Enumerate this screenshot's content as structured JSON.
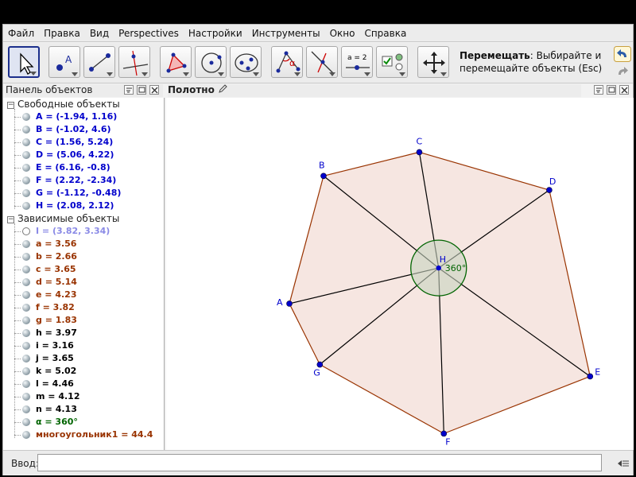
{
  "menu": [
    "Файл",
    "Правка",
    "Вид",
    "Perspectives",
    "Настройки",
    "Инструменты",
    "Окно",
    "Справка"
  ],
  "toolbar": {
    "tools": [
      {
        "name": "move-tool-icon",
        "selected": true
      },
      {
        "name": "point-tool-icon",
        "selected": false
      },
      {
        "name": "segment-tool-icon",
        "selected": false
      },
      {
        "name": "perpendicular-line-tool-icon",
        "selected": false
      },
      {
        "name": "polygon-tool-icon",
        "selected": false
      },
      {
        "name": "circle-center-point-tool-icon",
        "selected": false
      },
      {
        "name": "conic-tool-icon",
        "selected": false
      },
      {
        "name": "angle-tool-icon",
        "selected": false
      },
      {
        "name": "reflect-tool-icon",
        "selected": false
      },
      {
        "name": "slider-tool-icon",
        "selected": false
      },
      {
        "name": "checkbox-tool-icon",
        "selected": false
      },
      {
        "name": "move-graphics-view-tool-icon",
        "selected": false
      }
    ],
    "slider_label": "a = 2",
    "help_title": "Перемещать",
    "help_text": ": Выбирайте и перемещайте объекты (Esc)"
  },
  "algebra_panel": {
    "title": "Панель объектов",
    "free_group": "Свободные объекты",
    "dependent_group": "Зависимые объекты",
    "free_objects": [
      {
        "text": "A = (-1.94, 1.16)",
        "color": "#0000cc"
      },
      {
        "text": "B = (-1.02, 4.6)",
        "color": "#0000cc"
      },
      {
        "text": "C = (1.56, 5.24)",
        "color": "#0000cc"
      },
      {
        "text": "D = (5.06, 4.22)",
        "color": "#0000cc"
      },
      {
        "text": "E = (6.16, -0.8)",
        "color": "#0000cc"
      },
      {
        "text": "F = (2.22, -2.34)",
        "color": "#0000cc"
      },
      {
        "text": "G = (-1.12, -0.48)",
        "color": "#0000cc"
      },
      {
        "text": "H = (2.08, 2.12)",
        "color": "#0000cc"
      }
    ],
    "dependent_objects": [
      {
        "text": "I = (3.82, 3.34)",
        "color": "#8a8ae6",
        "hidden": true
      },
      {
        "text": "a = 3.56",
        "color": "#993300"
      },
      {
        "text": "b = 2.66",
        "color": "#993300"
      },
      {
        "text": "c = 3.65",
        "color": "#993300"
      },
      {
        "text": "d = 5.14",
        "color": "#993300"
      },
      {
        "text": "e = 4.23",
        "color": "#993300"
      },
      {
        "text": "f = 3.82",
        "color": "#993300"
      },
      {
        "text": "g = 1.83",
        "color": "#993300"
      },
      {
        "text": "h = 3.97",
        "color": "#000000"
      },
      {
        "text": "i = 3.16",
        "color": "#000000"
      },
      {
        "text": "j = 3.65",
        "color": "#000000"
      },
      {
        "text": "k = 5.02",
        "color": "#000000"
      },
      {
        "text": "l = 4.46",
        "color": "#000000"
      },
      {
        "text": "m = 4.12",
        "color": "#000000"
      },
      {
        "text": "n = 4.13",
        "color": "#000000"
      },
      {
        "text": "α = 360°",
        "color": "#006400"
      },
      {
        "text": "многоугольник1 = 44.4",
        "color": "#993300"
      }
    ]
  },
  "graphics_panel": {
    "title": "Полотно",
    "points": [
      {
        "label": "A",
        "x": -1.94,
        "y": 1.16
      },
      {
        "label": "B",
        "x": -1.02,
        "y": 4.6
      },
      {
        "label": "C",
        "x": 1.56,
        "y": 5.24
      },
      {
        "label": "D",
        "x": 5.06,
        "y": 4.22
      },
      {
        "label": "E",
        "x": 6.16,
        "y": -0.8
      },
      {
        "label": "F",
        "x": 2.22,
        "y": -2.34
      },
      {
        "label": "G",
        "x": -1.12,
        "y": -0.48
      }
    ],
    "center": {
      "label": "H",
      "x": 2.08,
      "y": 2.12
    },
    "polygon_order": [
      "A",
      "B",
      "C",
      "D",
      "E",
      "F",
      "G"
    ],
    "angle_label": "360°",
    "colors": {
      "point": "#0000cc",
      "polygon_fill": "#f4e2dc",
      "polygon_edge": "#993300",
      "spoke": "#000000",
      "angle_fill": "#c8d4c0",
      "angle_edge": "#006400",
      "label": "#0000cc"
    }
  },
  "input_bar": {
    "label": "Ввод:",
    "value": ""
  }
}
